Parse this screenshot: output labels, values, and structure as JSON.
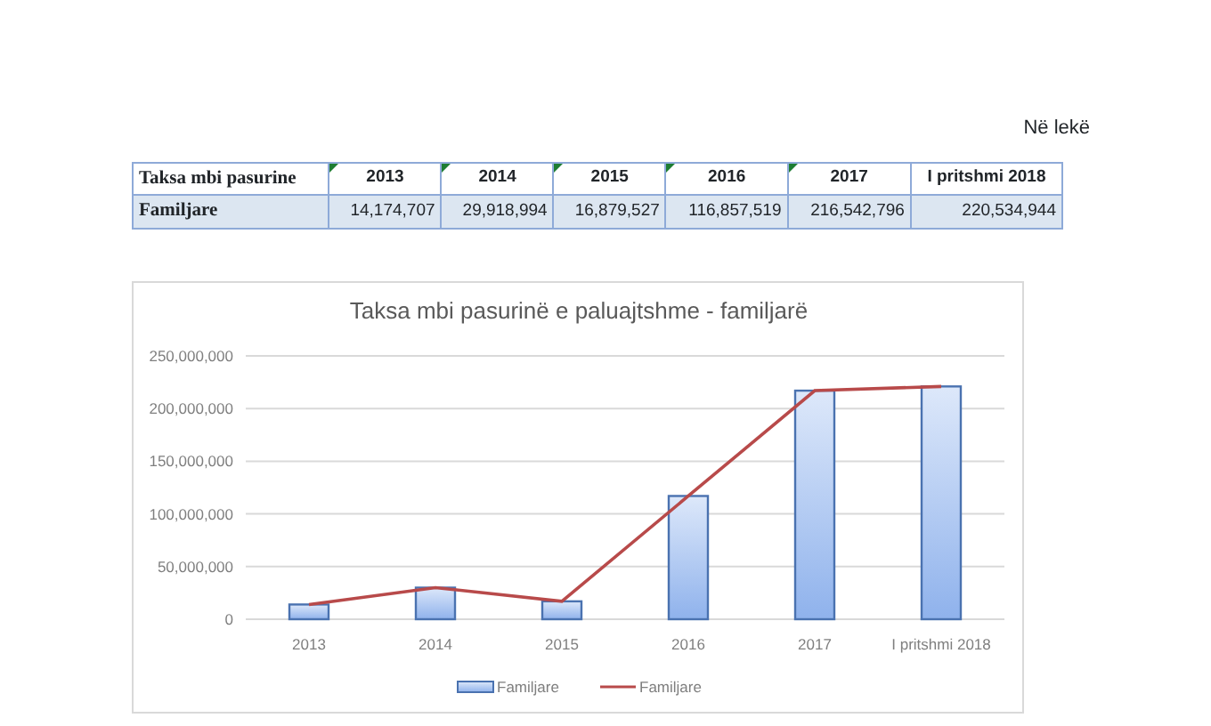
{
  "unit_note": "Në lekë",
  "table": {
    "corner": "Taksa mbi pasurine",
    "columns": [
      {
        "label": "2013",
        "flagged": true
      },
      {
        "label": "2014",
        "flagged": true
      },
      {
        "label": "2015",
        "flagged": true
      },
      {
        "label": "2016",
        "flagged": true
      },
      {
        "label": "2017",
        "flagged": true
      },
      {
        "label": "I pritshmi 2018",
        "flagged": false
      }
    ],
    "rows": [
      {
        "label": "Familjare",
        "cells": [
          "14,174,707",
          "29,918,994",
          "16,879,527",
          "116,857,519",
          "216,542,796",
          "220,534,944"
        ]
      }
    ]
  },
  "chart": {
    "chart_data": {
      "type": "bar",
      "title": "Taksa mbi pasurinë e paluajtshme - familjarë",
      "categories": [
        "2013",
        "2014",
        "2015",
        "2016",
        "2017",
        "I pritshmi 2018"
      ],
      "series": [
        {
          "name": "Familjare",
          "type": "bar",
          "color": "#4a72b0",
          "values": [
            14000000,
            30000000,
            17000000,
            117000000,
            217000000,
            221000000
          ]
        },
        {
          "name": "Familjare",
          "type": "line",
          "color": "#b84a4a",
          "values": [
            14000000,
            30000000,
            17000000,
            117000000,
            217000000,
            221000000
          ]
        }
      ],
      "ylim": [
        0,
        250000000
      ],
      "grid": true,
      "yticks": [
        {
          "value": 0,
          "label": "0"
        },
        {
          "value": 50000000,
          "label": "50,000,000"
        },
        {
          "value": 100000000,
          "label": "100,000,000"
        },
        {
          "value": 150000000,
          "label": "150,000,000"
        },
        {
          "value": 200000000,
          "label": "200,000,000"
        },
        {
          "value": 250000000,
          "label": "250,000,000"
        }
      ]
    }
  }
}
